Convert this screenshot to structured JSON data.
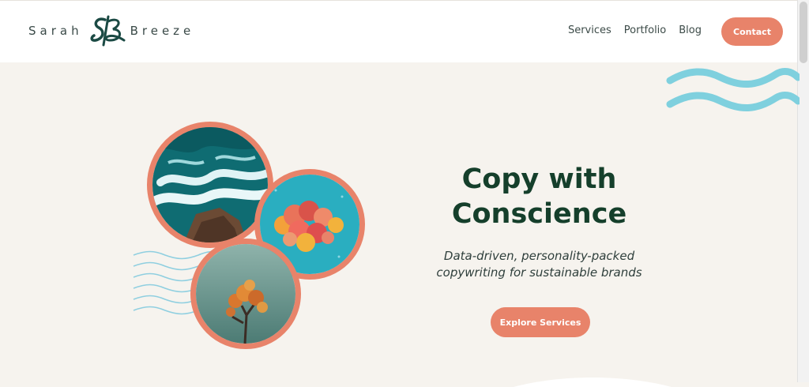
{
  "header": {
    "logo": {
      "first_name": "Sarah",
      "last_name": "Breeze",
      "monogram": "SB"
    },
    "nav": {
      "services": "Services",
      "portfolio": "Portfolio",
      "blog": "Blog"
    },
    "contact_label": "Contact"
  },
  "hero": {
    "title_line1": "Copy with",
    "title_line2": "Conscience",
    "subtitle_line1": "Data-driven, personality-packed",
    "subtitle_line2": "copywriting for sustainable brands",
    "cta_label": "Explore Services"
  },
  "images": {
    "ocean": "ocean-waves-photo",
    "flowers": "flowers-on-teal-photo",
    "tree": "autumn-tree-photo"
  },
  "colors": {
    "accent": "#e8836a",
    "heading": "#153f2b",
    "background": "#f6f3ee",
    "wave": "#7fd0de"
  }
}
